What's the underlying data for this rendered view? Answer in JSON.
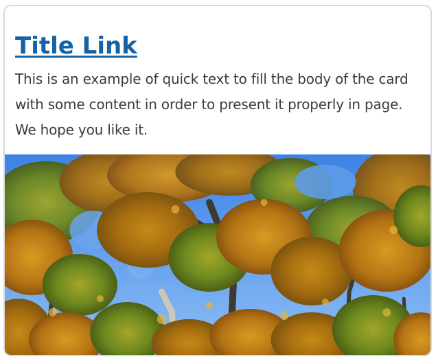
{
  "card": {
    "title": "Title Link",
    "body_text": "This is an example of quick text to fill the body of the card with some content in order to present it properly in page. We hope you like it.",
    "colors": {
      "title_link": "#1662a6",
      "body_text": "#3b3b3b",
      "border": "#d9d9d9",
      "sky": "#4f8fe8"
    },
    "image_icon": "autumn-forest-photo"
  }
}
